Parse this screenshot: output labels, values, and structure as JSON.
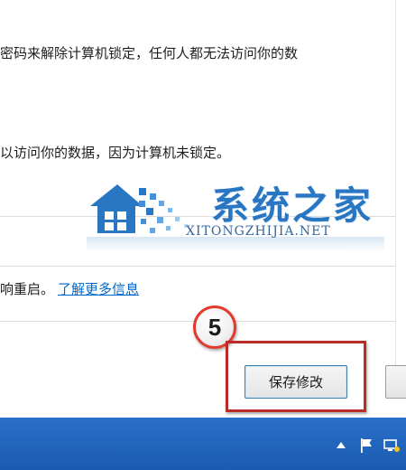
{
  "dialog": {
    "line1": "密码来解除计算机锁定，任何人都无法访问你的数",
    "line2": "以访问你的数据，因为计算机未锁定。",
    "line3_text": "响重启。",
    "line3_link": "了解更多信息"
  },
  "watermark": {
    "cn": "系统之家",
    "en": "XITONGZHIJIA.NET"
  },
  "annotation": {
    "step": "5",
    "color": "#bb2b27"
  },
  "buttons": {
    "save_label": "保存修改",
    "cancel_label": ""
  },
  "taskbar": {
    "color": "#1b5cb2",
    "tray_icons": [
      "show-hidden-icons-icon",
      "action-center-flag-icon",
      "network-icon"
    ]
  },
  "colors": {
    "link": "#0066cc",
    "accent": "#1e6fbf"
  }
}
